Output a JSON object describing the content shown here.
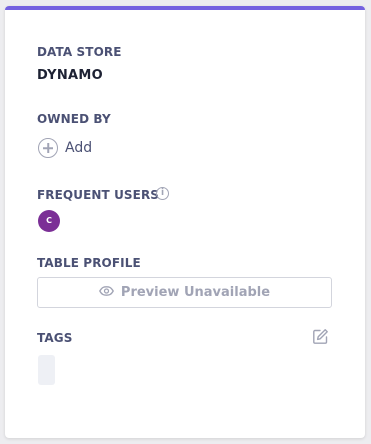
{
  "data_store": {
    "label": "DATA STORE",
    "value": "DYNAMO"
  },
  "owned_by": {
    "label": "OWNED BY",
    "add_label": "Add"
  },
  "frequent_users": {
    "label": "FREQUENT USERS",
    "info_icon": "i",
    "users": [
      {
        "initial": "C",
        "color": "#7b2f96"
      }
    ]
  },
  "table_profile": {
    "label": "TABLE PROFILE",
    "button_label": "Preview Unavailable"
  },
  "tags": {
    "label": "TAGS"
  },
  "colors": {
    "accent": "#7461e0"
  }
}
